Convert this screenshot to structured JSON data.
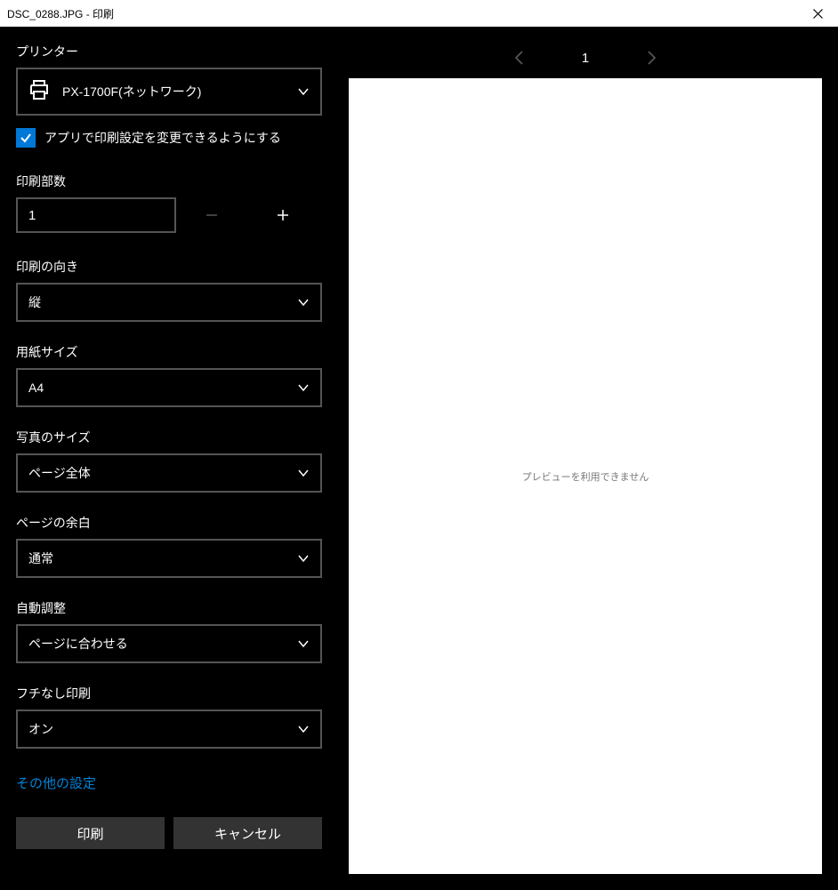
{
  "titlebar": {
    "title": "DSC_0288.JPG - 印刷"
  },
  "left": {
    "printer_label": "プリンター",
    "printer_selected": "PX-1700F(ネットワーク)",
    "app_settings_checkbox": "アプリで印刷設定を変更できるようにする",
    "copies_label": "印刷部数",
    "copies_value": "1",
    "orientation_label": "印刷の向き",
    "orientation_value": "縦",
    "paper_size_label": "用紙サイズ",
    "paper_size_value": "A4",
    "photo_size_label": "写真のサイズ",
    "photo_size_value": "ページ全体",
    "margins_label": "ページの余白",
    "margins_value": "通常",
    "fit_label": "自動調整",
    "fit_value": "ページに合わせる",
    "borderless_label": "フチなし印刷",
    "borderless_value": "オン",
    "more_settings": "その他の設定",
    "print_btn": "印刷",
    "cancel_btn": "キャンセル"
  },
  "right": {
    "page_current": "1",
    "preview_unavailable": "プレビューを利用できません"
  }
}
